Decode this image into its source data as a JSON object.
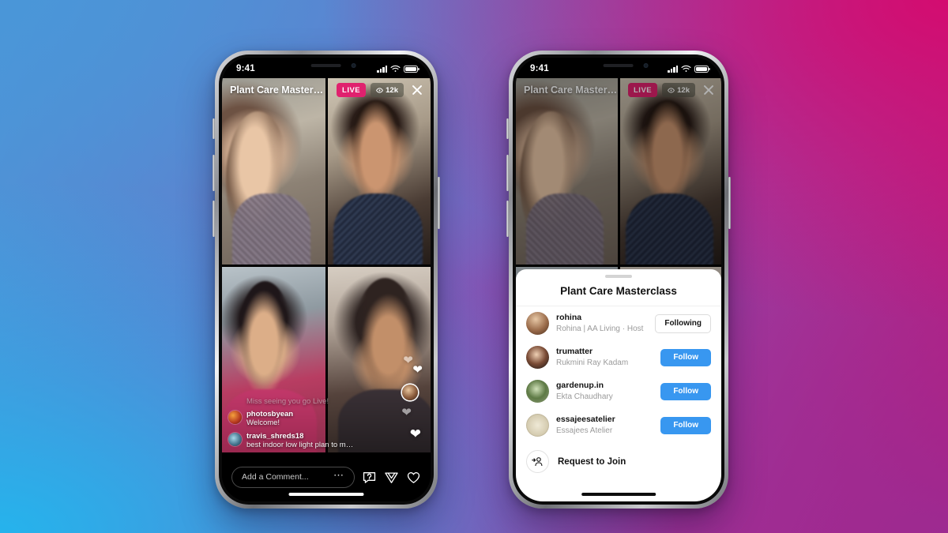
{
  "background": {
    "gradient_colors": [
      "#4d96d8",
      "#22b6ee",
      "#7a6ac0",
      "#962e96",
      "#c41374"
    ]
  },
  "status_bar": {
    "time": "9:41",
    "signal_icon": "cellular-bars-icon",
    "wifi_icon": "wifi-icon",
    "battery_icon": "battery-icon"
  },
  "live": {
    "title": "Plant Care Mastercla...",
    "live_badge": "LIVE",
    "viewer_count": "12k",
    "viewer_icon": "eye-icon",
    "close_icon": "close-icon",
    "live_badge_color": "#e0216e",
    "tiles": [
      {
        "name": "host-video-tile"
      },
      {
        "name": "guest-video-tile-1"
      },
      {
        "name": "guest-video-tile-2"
      },
      {
        "name": "guest-video-tile-3"
      }
    ],
    "comments": {
      "faded": "Miss seeing you go Live!",
      "items": [
        {
          "user": "photosbyean",
          "text": "Welcome!"
        },
        {
          "user": "travis_shreds18",
          "text": "best indoor low light plan to maintain?"
        }
      ]
    },
    "composer": {
      "placeholder": "Add a Comment...",
      "more_icon": "ellipsis-icon",
      "question_icon": "question-bubble-icon",
      "share_icon": "paper-plane-icon",
      "like_icon": "heart-icon"
    },
    "reactions": {
      "heart_icon": "heart-icon",
      "avatar_icon": "reaction-avatar-icon"
    }
  },
  "sheet": {
    "grabber": "drag-handle",
    "title": "Plant Care Masterclass",
    "people": [
      {
        "username": "rohina",
        "subtitle": "Rohina | AA Living · Host",
        "action": "Following",
        "action_style": "outline"
      },
      {
        "username": "trumatter",
        "subtitle": "Rukmini Ray Kadam",
        "action": "Follow",
        "action_style": "filled"
      },
      {
        "username": "gardenup.in",
        "subtitle": "Ekta Chaudhary",
        "action": "Follow",
        "action_style": "filled"
      },
      {
        "username": "essajeesatelier",
        "subtitle": "Essajees Atelier",
        "action": "Follow",
        "action_style": "filled"
      }
    ],
    "request": {
      "label": "Request to Join",
      "icon": "add-person-icon"
    },
    "follow_color": "#3897f0"
  }
}
